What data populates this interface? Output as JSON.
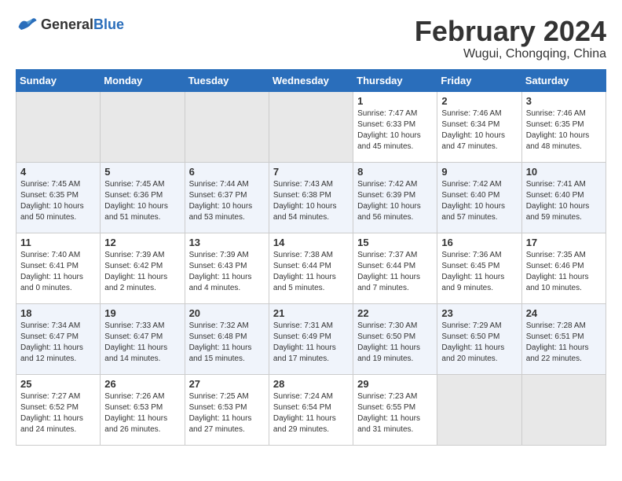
{
  "header": {
    "logo_general": "General",
    "logo_blue": "Blue",
    "month_year": "February 2024",
    "location": "Wugui, Chongqing, China"
  },
  "days_of_week": [
    "Sunday",
    "Monday",
    "Tuesday",
    "Wednesday",
    "Thursday",
    "Friday",
    "Saturday"
  ],
  "weeks": [
    [
      {
        "day": "",
        "info": ""
      },
      {
        "day": "",
        "info": ""
      },
      {
        "day": "",
        "info": ""
      },
      {
        "day": "",
        "info": ""
      },
      {
        "day": "1",
        "info": "Sunrise: 7:47 AM\nSunset: 6:33 PM\nDaylight: 10 hours\nand 45 minutes."
      },
      {
        "day": "2",
        "info": "Sunrise: 7:46 AM\nSunset: 6:34 PM\nDaylight: 10 hours\nand 47 minutes."
      },
      {
        "day": "3",
        "info": "Sunrise: 7:46 AM\nSunset: 6:35 PM\nDaylight: 10 hours\nand 48 minutes."
      }
    ],
    [
      {
        "day": "4",
        "info": "Sunrise: 7:45 AM\nSunset: 6:35 PM\nDaylight: 10 hours\nand 50 minutes."
      },
      {
        "day": "5",
        "info": "Sunrise: 7:45 AM\nSunset: 6:36 PM\nDaylight: 10 hours\nand 51 minutes."
      },
      {
        "day": "6",
        "info": "Sunrise: 7:44 AM\nSunset: 6:37 PM\nDaylight: 10 hours\nand 53 minutes."
      },
      {
        "day": "7",
        "info": "Sunrise: 7:43 AM\nSunset: 6:38 PM\nDaylight: 10 hours\nand 54 minutes."
      },
      {
        "day": "8",
        "info": "Sunrise: 7:42 AM\nSunset: 6:39 PM\nDaylight: 10 hours\nand 56 minutes."
      },
      {
        "day": "9",
        "info": "Sunrise: 7:42 AM\nSunset: 6:40 PM\nDaylight: 10 hours\nand 57 minutes."
      },
      {
        "day": "10",
        "info": "Sunrise: 7:41 AM\nSunset: 6:40 PM\nDaylight: 10 hours\nand 59 minutes."
      }
    ],
    [
      {
        "day": "11",
        "info": "Sunrise: 7:40 AM\nSunset: 6:41 PM\nDaylight: 11 hours\nand 0 minutes."
      },
      {
        "day": "12",
        "info": "Sunrise: 7:39 AM\nSunset: 6:42 PM\nDaylight: 11 hours\nand 2 minutes."
      },
      {
        "day": "13",
        "info": "Sunrise: 7:39 AM\nSunset: 6:43 PM\nDaylight: 11 hours\nand 4 minutes."
      },
      {
        "day": "14",
        "info": "Sunrise: 7:38 AM\nSunset: 6:44 PM\nDaylight: 11 hours\nand 5 minutes."
      },
      {
        "day": "15",
        "info": "Sunrise: 7:37 AM\nSunset: 6:44 PM\nDaylight: 11 hours\nand 7 minutes."
      },
      {
        "day": "16",
        "info": "Sunrise: 7:36 AM\nSunset: 6:45 PM\nDaylight: 11 hours\nand 9 minutes."
      },
      {
        "day": "17",
        "info": "Sunrise: 7:35 AM\nSunset: 6:46 PM\nDaylight: 11 hours\nand 10 minutes."
      }
    ],
    [
      {
        "day": "18",
        "info": "Sunrise: 7:34 AM\nSunset: 6:47 PM\nDaylight: 11 hours\nand 12 minutes."
      },
      {
        "day": "19",
        "info": "Sunrise: 7:33 AM\nSunset: 6:47 PM\nDaylight: 11 hours\nand 14 minutes."
      },
      {
        "day": "20",
        "info": "Sunrise: 7:32 AM\nSunset: 6:48 PM\nDaylight: 11 hours\nand 15 minutes."
      },
      {
        "day": "21",
        "info": "Sunrise: 7:31 AM\nSunset: 6:49 PM\nDaylight: 11 hours\nand 17 minutes."
      },
      {
        "day": "22",
        "info": "Sunrise: 7:30 AM\nSunset: 6:50 PM\nDaylight: 11 hours\nand 19 minutes."
      },
      {
        "day": "23",
        "info": "Sunrise: 7:29 AM\nSunset: 6:50 PM\nDaylight: 11 hours\nand 20 minutes."
      },
      {
        "day": "24",
        "info": "Sunrise: 7:28 AM\nSunset: 6:51 PM\nDaylight: 11 hours\nand 22 minutes."
      }
    ],
    [
      {
        "day": "25",
        "info": "Sunrise: 7:27 AM\nSunset: 6:52 PM\nDaylight: 11 hours\nand 24 minutes."
      },
      {
        "day": "26",
        "info": "Sunrise: 7:26 AM\nSunset: 6:53 PM\nDaylight: 11 hours\nand 26 minutes."
      },
      {
        "day": "27",
        "info": "Sunrise: 7:25 AM\nSunset: 6:53 PM\nDaylight: 11 hours\nand 27 minutes."
      },
      {
        "day": "28",
        "info": "Sunrise: 7:24 AM\nSunset: 6:54 PM\nDaylight: 11 hours\nand 29 minutes."
      },
      {
        "day": "29",
        "info": "Sunrise: 7:23 AM\nSunset: 6:55 PM\nDaylight: 11 hours\nand 31 minutes."
      },
      {
        "day": "",
        "info": ""
      },
      {
        "day": "",
        "info": ""
      }
    ]
  ]
}
